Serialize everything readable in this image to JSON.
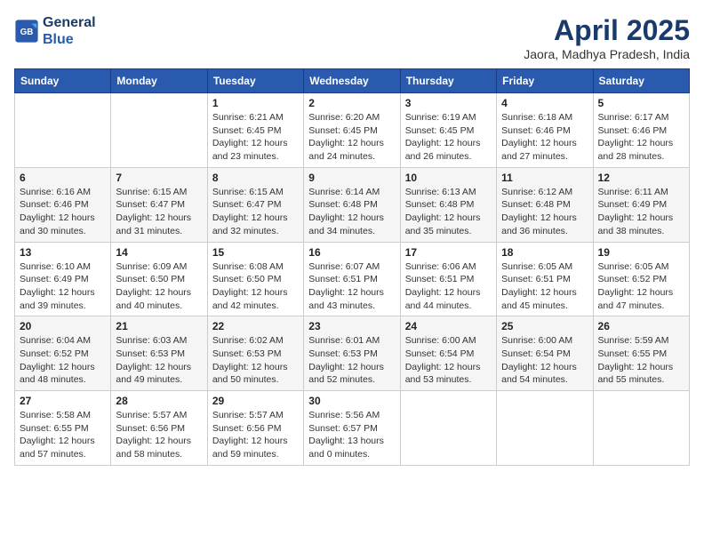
{
  "header": {
    "logo_line1": "General",
    "logo_line2": "Blue",
    "month_title": "April 2025",
    "subtitle": "Jaora, Madhya Pradesh, India"
  },
  "weekdays": [
    "Sunday",
    "Monday",
    "Tuesday",
    "Wednesday",
    "Thursday",
    "Friday",
    "Saturday"
  ],
  "weeks": [
    [
      {
        "day": "",
        "sunrise": "",
        "sunset": "",
        "daylight": ""
      },
      {
        "day": "",
        "sunrise": "",
        "sunset": "",
        "daylight": ""
      },
      {
        "day": "1",
        "sunrise": "Sunrise: 6:21 AM",
        "sunset": "Sunset: 6:45 PM",
        "daylight": "Daylight: 12 hours and 23 minutes."
      },
      {
        "day": "2",
        "sunrise": "Sunrise: 6:20 AM",
        "sunset": "Sunset: 6:45 PM",
        "daylight": "Daylight: 12 hours and 24 minutes."
      },
      {
        "day": "3",
        "sunrise": "Sunrise: 6:19 AM",
        "sunset": "Sunset: 6:45 PM",
        "daylight": "Daylight: 12 hours and 26 minutes."
      },
      {
        "day": "4",
        "sunrise": "Sunrise: 6:18 AM",
        "sunset": "Sunset: 6:46 PM",
        "daylight": "Daylight: 12 hours and 27 minutes."
      },
      {
        "day": "5",
        "sunrise": "Sunrise: 6:17 AM",
        "sunset": "Sunset: 6:46 PM",
        "daylight": "Daylight: 12 hours and 28 minutes."
      }
    ],
    [
      {
        "day": "6",
        "sunrise": "Sunrise: 6:16 AM",
        "sunset": "Sunset: 6:46 PM",
        "daylight": "Daylight: 12 hours and 30 minutes."
      },
      {
        "day": "7",
        "sunrise": "Sunrise: 6:15 AM",
        "sunset": "Sunset: 6:47 PM",
        "daylight": "Daylight: 12 hours and 31 minutes."
      },
      {
        "day": "8",
        "sunrise": "Sunrise: 6:15 AM",
        "sunset": "Sunset: 6:47 PM",
        "daylight": "Daylight: 12 hours and 32 minutes."
      },
      {
        "day": "9",
        "sunrise": "Sunrise: 6:14 AM",
        "sunset": "Sunset: 6:48 PM",
        "daylight": "Daylight: 12 hours and 34 minutes."
      },
      {
        "day": "10",
        "sunrise": "Sunrise: 6:13 AM",
        "sunset": "Sunset: 6:48 PM",
        "daylight": "Daylight: 12 hours and 35 minutes."
      },
      {
        "day": "11",
        "sunrise": "Sunrise: 6:12 AM",
        "sunset": "Sunset: 6:48 PM",
        "daylight": "Daylight: 12 hours and 36 minutes."
      },
      {
        "day": "12",
        "sunrise": "Sunrise: 6:11 AM",
        "sunset": "Sunset: 6:49 PM",
        "daylight": "Daylight: 12 hours and 38 minutes."
      }
    ],
    [
      {
        "day": "13",
        "sunrise": "Sunrise: 6:10 AM",
        "sunset": "Sunset: 6:49 PM",
        "daylight": "Daylight: 12 hours and 39 minutes."
      },
      {
        "day": "14",
        "sunrise": "Sunrise: 6:09 AM",
        "sunset": "Sunset: 6:50 PM",
        "daylight": "Daylight: 12 hours and 40 minutes."
      },
      {
        "day": "15",
        "sunrise": "Sunrise: 6:08 AM",
        "sunset": "Sunset: 6:50 PM",
        "daylight": "Daylight: 12 hours and 42 minutes."
      },
      {
        "day": "16",
        "sunrise": "Sunrise: 6:07 AM",
        "sunset": "Sunset: 6:51 PM",
        "daylight": "Daylight: 12 hours and 43 minutes."
      },
      {
        "day": "17",
        "sunrise": "Sunrise: 6:06 AM",
        "sunset": "Sunset: 6:51 PM",
        "daylight": "Daylight: 12 hours and 44 minutes."
      },
      {
        "day": "18",
        "sunrise": "Sunrise: 6:05 AM",
        "sunset": "Sunset: 6:51 PM",
        "daylight": "Daylight: 12 hours and 45 minutes."
      },
      {
        "day": "19",
        "sunrise": "Sunrise: 6:05 AM",
        "sunset": "Sunset: 6:52 PM",
        "daylight": "Daylight: 12 hours and 47 minutes."
      }
    ],
    [
      {
        "day": "20",
        "sunrise": "Sunrise: 6:04 AM",
        "sunset": "Sunset: 6:52 PM",
        "daylight": "Daylight: 12 hours and 48 minutes."
      },
      {
        "day": "21",
        "sunrise": "Sunrise: 6:03 AM",
        "sunset": "Sunset: 6:53 PM",
        "daylight": "Daylight: 12 hours and 49 minutes."
      },
      {
        "day": "22",
        "sunrise": "Sunrise: 6:02 AM",
        "sunset": "Sunset: 6:53 PM",
        "daylight": "Daylight: 12 hours and 50 minutes."
      },
      {
        "day": "23",
        "sunrise": "Sunrise: 6:01 AM",
        "sunset": "Sunset: 6:53 PM",
        "daylight": "Daylight: 12 hours and 52 minutes."
      },
      {
        "day": "24",
        "sunrise": "Sunrise: 6:00 AM",
        "sunset": "Sunset: 6:54 PM",
        "daylight": "Daylight: 12 hours and 53 minutes."
      },
      {
        "day": "25",
        "sunrise": "Sunrise: 6:00 AM",
        "sunset": "Sunset: 6:54 PM",
        "daylight": "Daylight: 12 hours and 54 minutes."
      },
      {
        "day": "26",
        "sunrise": "Sunrise: 5:59 AM",
        "sunset": "Sunset: 6:55 PM",
        "daylight": "Daylight: 12 hours and 55 minutes."
      }
    ],
    [
      {
        "day": "27",
        "sunrise": "Sunrise: 5:58 AM",
        "sunset": "Sunset: 6:55 PM",
        "daylight": "Daylight: 12 hours and 57 minutes."
      },
      {
        "day": "28",
        "sunrise": "Sunrise: 5:57 AM",
        "sunset": "Sunset: 6:56 PM",
        "daylight": "Daylight: 12 hours and 58 minutes."
      },
      {
        "day": "29",
        "sunrise": "Sunrise: 5:57 AM",
        "sunset": "Sunset: 6:56 PM",
        "daylight": "Daylight: 12 hours and 59 minutes."
      },
      {
        "day": "30",
        "sunrise": "Sunrise: 5:56 AM",
        "sunset": "Sunset: 6:57 PM",
        "daylight": "Daylight: 13 hours and 0 minutes."
      },
      {
        "day": "",
        "sunrise": "",
        "sunset": "",
        "daylight": ""
      },
      {
        "day": "",
        "sunrise": "",
        "sunset": "",
        "daylight": ""
      },
      {
        "day": "",
        "sunrise": "",
        "sunset": "",
        "daylight": ""
      }
    ]
  ]
}
